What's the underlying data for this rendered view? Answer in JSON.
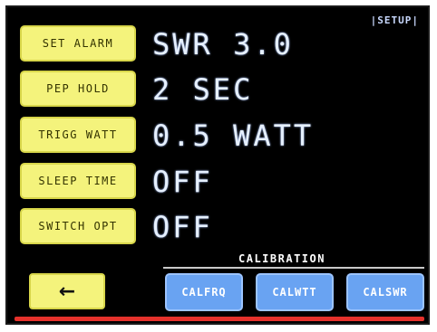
{
  "header": {
    "page_label": "|SETUP|"
  },
  "menu": {
    "items": [
      {
        "label": "SET ALARM",
        "value": "SWR 3.0"
      },
      {
        "label": "PEP HOLD",
        "value": "2 SEC"
      },
      {
        "label": "TRIGG WATT",
        "value": "0.5 WATT"
      },
      {
        "label": "SLEEP TIME",
        "value": "OFF"
      },
      {
        "label": "SWITCH OPT",
        "value": "OFF"
      }
    ]
  },
  "calibration": {
    "title": "CALIBRATION",
    "buttons": [
      {
        "label": "CALFRQ"
      },
      {
        "label": "CALWTT"
      },
      {
        "label": "CALSWR"
      }
    ]
  },
  "nav": {
    "back_label": "←"
  },
  "colors": {
    "screen_bg": "#000000",
    "menu_button": "#f4f37c",
    "calib_button": "#69a3f2",
    "value_text": "#e6f0ff",
    "bottom_bar": "#e5312b"
  }
}
